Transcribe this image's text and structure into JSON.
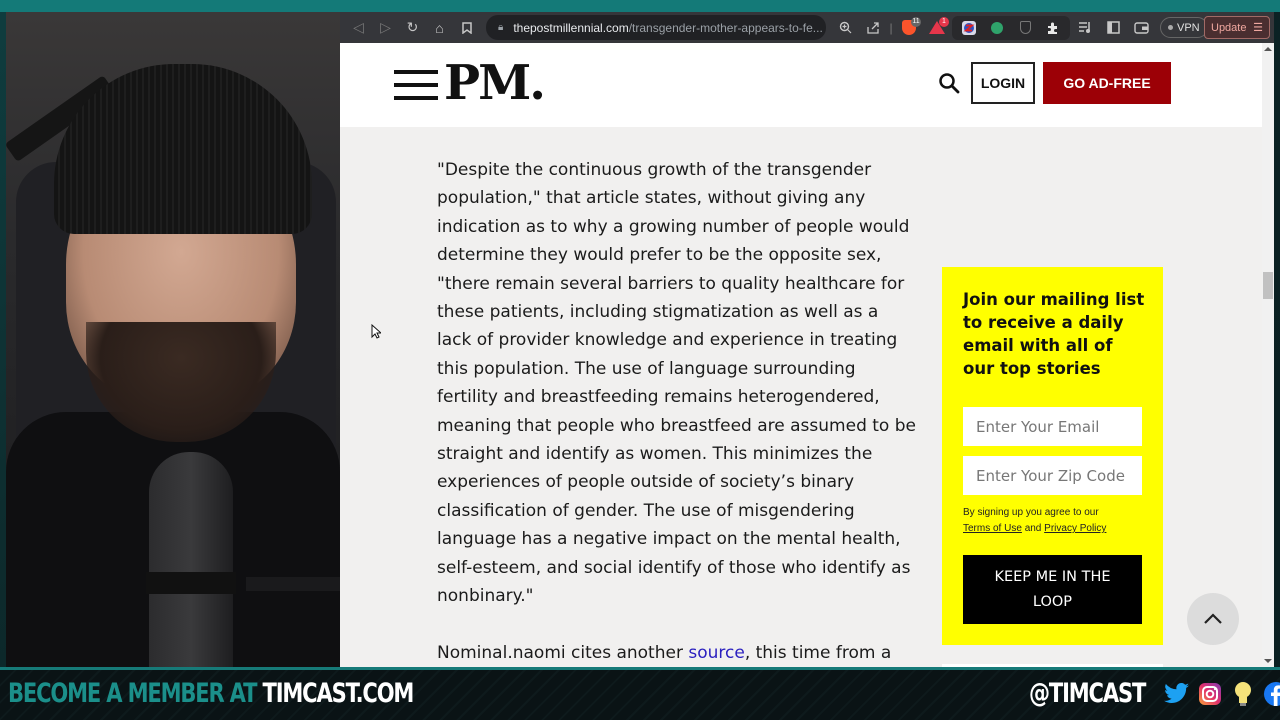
{
  "browser": {
    "url_host": "thepostmillennial.com",
    "url_path": "/transgender-mother-appears-to-fe...",
    "brave_shield_count": "11",
    "rewards_badge": "1",
    "vpn_label": "VPN",
    "update_label": "Update"
  },
  "site": {
    "logo": "PM.",
    "login_label": "LOGIN",
    "adfree_label": "GO AD-FREE"
  },
  "article": {
    "quote_paragraph": "\"Despite the continuous growth of the transgender population,\" that article states, without giving any indication as to why a growing number of people would determine they would prefer to be the opposite sex, \"there remain several barriers to quality healthcare for these patients, including stigmatization as well as a lack of provider knowledge and experience in treating this population. The use of language surrounding fertility and breastfeeding remains heterogendered, meaning that people who breastfeed are assumed to be straight and identify as women. This minimizes the experiences of people outside of society’s binary classification of gender. The use of misgendering language has a negative impact on the mental health, self-esteem, and social identify of those who identify as nonbinary.\"",
    "next_paragraph_before": "Nominal.naomi cites another ",
    "next_paragraph_link": "source",
    "next_paragraph_after": ", this time from a"
  },
  "signup": {
    "heading": "Join our mailing list to receive a daily email with all of our top stories",
    "email_placeholder": "Enter Your Email",
    "zip_placeholder": "Enter Your Zip Code",
    "legal_prefix": "By signing up you agree to our",
    "terms_label": "Terms of Use",
    "and_label": "and",
    "privacy_label": "Privacy Policy",
    "submit_label": "KEEP ME IN THE LOOP"
  },
  "banner": {
    "cta_teal": "BECOME A MEMBER AT ",
    "cta_white": "TIMCAST.COM",
    "handle": "@TIMCAST",
    "social_icons": [
      "twitter-icon",
      "instagram-icon",
      "lightbulb-icon",
      "facebook-icon"
    ]
  },
  "colors": {
    "brand_red": "#9c0006",
    "signup_yellow": "#ffff00",
    "link_blue": "#2a1fbf",
    "stream_teal": "#1b8f8a"
  }
}
